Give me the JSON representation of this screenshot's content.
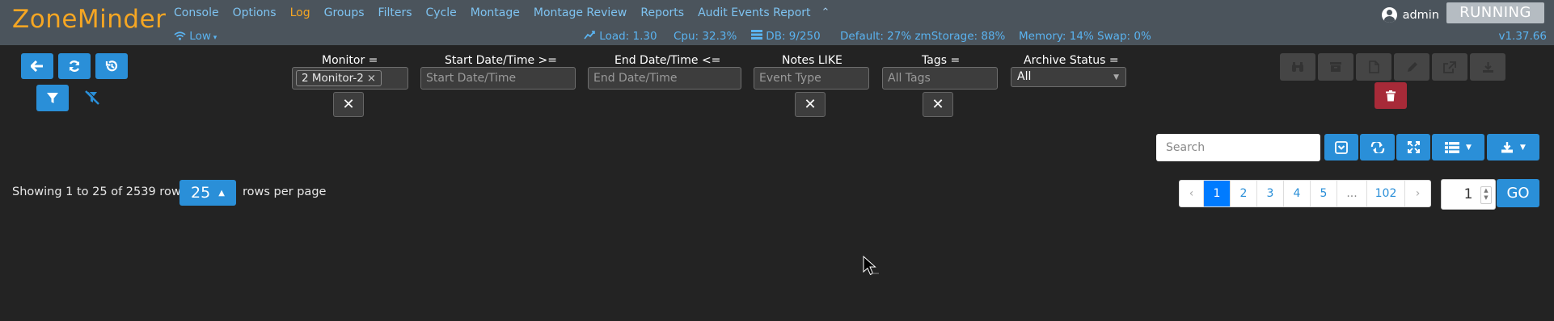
{
  "app": {
    "logo": "ZoneMinder",
    "status_button": "RUNNING",
    "version": "v1.37.66",
    "user": "admin"
  },
  "nav": {
    "items": [
      "Console",
      "Options",
      "Log",
      "Groups",
      "Filters",
      "Cycle",
      "Montage",
      "Montage Review",
      "Reports",
      "Audit Events Report"
    ],
    "active": "Log",
    "collapse_glyph": "⌃"
  },
  "stats": {
    "bandwidth": "Low",
    "load": "Load: 1.30",
    "cpu": "Cpu: 32.3%",
    "db": "DB: 9/250",
    "storage": "Default: 27% zmStorage: 88%",
    "memory": "Memory: 14% Swap: 0%"
  },
  "filters": {
    "monitor_label": "Monitor  =",
    "monitor_chip": "2 Monitor-2",
    "chip_remove": "×",
    "start_label": "Start Date/Time  >=",
    "start_placeholder": "Start Date/Time",
    "end_label": "End Date/Time  <=",
    "end_placeholder": "End Date/Time",
    "notes_label": "Notes  LIKE",
    "notes_placeholder": "Event Type",
    "tags_label": "Tags  =",
    "tags_placeholder": "All Tags",
    "archive_label": "Archive Status  =",
    "archive_value": "All",
    "clear_glyph": "✕"
  },
  "table_toolbar": {
    "search_placeholder": "Search"
  },
  "pagination": {
    "showing": "Showing 1 to 25 of 2539 rows",
    "per_page": "25",
    "rows_per_page": "rows per page",
    "pages": [
      "‹",
      "1",
      "2",
      "3",
      "4",
      "5",
      "...",
      "102",
      "›"
    ],
    "current_page": "1",
    "go_value": "1",
    "go_label": "GO"
  },
  "colors": {
    "accent": "#2a8fd8",
    "logo": "#f5a623",
    "header_bg": "#4b545c",
    "danger": "#a72a38",
    "body_bg": "#232323"
  },
  "icons": [
    "back-arrow-icon",
    "refresh-icon",
    "history-icon",
    "filter-icon",
    "filter-clear-icon",
    "binoculars-icon",
    "archive-icon",
    "file-icon",
    "edit-icon",
    "export-icon",
    "download-icon",
    "trash-icon",
    "wifi-icon",
    "load-chart-icon",
    "database-icon",
    "user-icon"
  ]
}
